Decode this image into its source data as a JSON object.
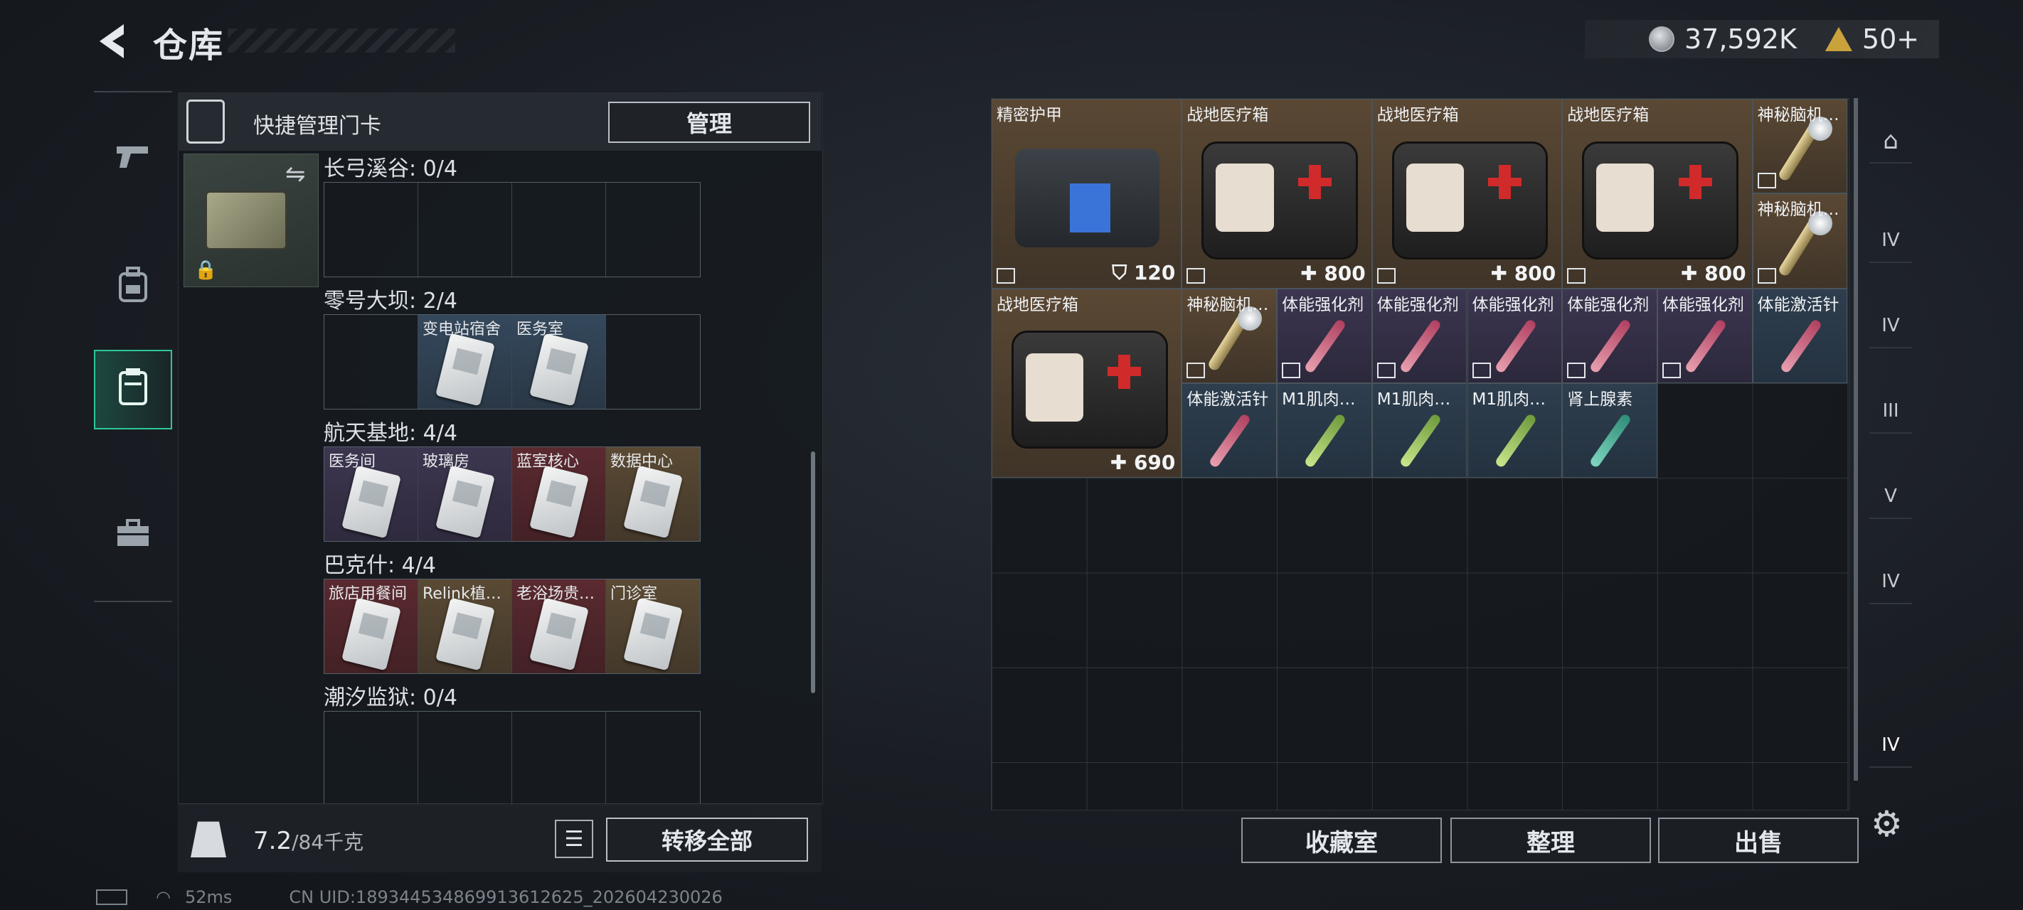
{
  "header": {
    "title": "仓库"
  },
  "currency": {
    "coins": "37,592K",
    "tickets": "50+"
  },
  "nav": {
    "items": [
      "weapon-icon",
      "backpack-icon",
      "keycard-icon",
      "toolbox-icon"
    ]
  },
  "keycards": {
    "panel_title": "快捷管理门卡",
    "manage_label": "管理",
    "sections": [
      {
        "title": "长弓溪谷: 0/4",
        "slots": [
          {
            "label": "",
            "rarity": ""
          },
          {
            "label": "",
            "rarity": ""
          },
          {
            "label": "",
            "rarity": ""
          },
          {
            "label": "",
            "rarity": ""
          }
        ]
      },
      {
        "title": "零号大坝: 2/4",
        "slots": [
          {
            "label": "",
            "rarity": ""
          },
          {
            "label": "变电站宿舍",
            "rarity": "blue"
          },
          {
            "label": "医务室",
            "rarity": "blue"
          },
          {
            "label": "",
            "rarity": ""
          }
        ]
      },
      {
        "title": "航天基地: 4/4",
        "slots": [
          {
            "label": "医务间",
            "rarity": "purple"
          },
          {
            "label": "玻璃房",
            "rarity": "purple"
          },
          {
            "label": "蓝室核心",
            "rarity": "red"
          },
          {
            "label": "数据中心",
            "rarity": "gold"
          }
        ]
      },
      {
        "title": "巴克什: 4/4",
        "slots": [
          {
            "label": "旅店用餐间",
            "rarity": "red"
          },
          {
            "label": "Relink植…",
            "rarity": "gold"
          },
          {
            "label": "老浴场贵…",
            "rarity": "red"
          },
          {
            "label": "门诊室",
            "rarity": "gold"
          }
        ]
      },
      {
        "title": "潮汐监狱: 0/4",
        "slots": [
          {
            "label": "",
            "rarity": ""
          },
          {
            "label": "",
            "rarity": ""
          },
          {
            "label": "",
            "rarity": ""
          },
          {
            "label": "",
            "rarity": ""
          }
        ]
      }
    ],
    "weight_value": "7.2",
    "weight_capacity": "/84千克",
    "move_all_label": "转移全部"
  },
  "inventory": {
    "items": [
      {
        "name": "精密护甲",
        "value": "120",
        "rarity": "gold",
        "kind": "armor"
      },
      {
        "name": "战地医疗箱",
        "value": "800",
        "rarity": "gold",
        "kind": "medbox"
      },
      {
        "name": "战地医疗箱",
        "value": "800",
        "rarity": "gold",
        "kind": "medbox"
      },
      {
        "name": "战地医疗箱",
        "value": "800",
        "rarity": "gold",
        "kind": "medbox"
      },
      {
        "name": "神秘脑机…",
        "value": "",
        "rarity": "gold",
        "kind": "tube"
      },
      {
        "name": "神秘脑机…",
        "value": "",
        "rarity": "gold",
        "kind": "tube"
      },
      {
        "name": "战地医疗箱",
        "value": "690",
        "rarity": "gold",
        "kind": "medbox"
      },
      {
        "name": "神秘脑机…",
        "value": "",
        "rarity": "gold",
        "kind": "tube"
      },
      {
        "name": "体能强化剂",
        "value": "",
        "rarity": "purple",
        "kind": "syringe"
      },
      {
        "name": "体能强化剂",
        "value": "",
        "rarity": "purple",
        "kind": "syringe"
      },
      {
        "name": "体能强化剂",
        "value": "",
        "rarity": "purple",
        "kind": "syringe"
      },
      {
        "name": "体能强化剂",
        "value": "",
        "rarity": "purple",
        "kind": "syringe"
      },
      {
        "name": "体能强化剂",
        "value": "",
        "rarity": "purple",
        "kind": "syringe"
      },
      {
        "name": "体能激活针",
        "value": "",
        "rarity": "blue",
        "kind": "syringe"
      },
      {
        "name": "体能激活针",
        "value": "",
        "rarity": "blue",
        "kind": "syringe"
      },
      {
        "name": "M1肌肉…",
        "value": "",
        "rarity": "blue",
        "kind": "syringe-green"
      },
      {
        "name": "M1肌肉…",
        "value": "",
        "rarity": "blue",
        "kind": "syringe-green"
      },
      {
        "name": "M1肌肉…",
        "value": "",
        "rarity": "blue",
        "kind": "syringe-green"
      },
      {
        "name": "肾上腺素",
        "value": "",
        "rarity": "blue",
        "kind": "syringe-teal"
      }
    ],
    "buttons": {
      "collection": "收藏室",
      "sort": "整理",
      "sell": "出售"
    }
  },
  "rail": {
    "items": [
      "dome-icon",
      "IV",
      "IV",
      "III",
      "V",
      "IV",
      "IV"
    ]
  },
  "status": {
    "ping": "52ms",
    "uid": "CN UID:18934453486991361262​5_202604230026"
  },
  "colors": {
    "accent": "#2ec79a",
    "gold": "#5a4834",
    "purple": "#3c3650",
    "blue": "#2e3e4e",
    "red": "#5a2a30"
  }
}
